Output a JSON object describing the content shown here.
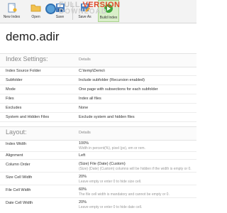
{
  "toolbar": {
    "buttons": [
      {
        "label": "New Index",
        "icon": "new-index-icon"
      },
      {
        "label": "Open",
        "icon": "open-folder-icon"
      },
      {
        "label": "Save",
        "icon": "save-icon"
      },
      {
        "label": "Save As",
        "icon": "save-as-icon"
      },
      {
        "label": "Build Index",
        "icon": "build-index-icon"
      }
    ]
  },
  "watermark": {
    "line1_a": "FULL",
    "line1_b": "VERSION",
    "line2": "DOWNLOAD"
  },
  "title": "demo.adir",
  "index_settings": {
    "heading": "Index Settings:",
    "details_label": "Details",
    "rows": [
      {
        "key": "Index Source Folder",
        "value": "C:\\temp\\Demo\\"
      },
      {
        "key": "Subfolder",
        "value": "Include subfolder (Recursion enabled)"
      },
      {
        "key": "Mode",
        "value": "One page with subsections for each subfolder"
      },
      {
        "key": "Files",
        "value": "Index all files"
      },
      {
        "key": "Excludes",
        "value": "None"
      },
      {
        "key": "System and Hidden Files",
        "value": "Exclude system and hidden files"
      }
    ]
  },
  "layout": {
    "heading": "Layout:",
    "details_label": "Details",
    "rows": [
      {
        "key": "Index Width",
        "value": "100%",
        "note": "Width in percent(%), pixel (px), em or rem."
      },
      {
        "key": "Alignment",
        "value": "Left",
        "note": ""
      },
      {
        "key": "Column Order",
        "value": "(Size) File (Date) (Custom)",
        "note": "(Size) (Date) (Custom) columns will be hidden if the width is empty or 0."
      },
      {
        "key": "Size Cell Width",
        "value": "20%",
        "note": "Leave empty or enter 0 to hide size cell."
      },
      {
        "key": "File Cell Width",
        "value": "60%",
        "note": "The file cell width is mandatory and cannot be empty or 0."
      },
      {
        "key": "Date Cell Width",
        "value": "20%",
        "note": "Leave empty or enter 0 to hide date cell."
      }
    ]
  },
  "colors": {
    "active_button": "#d9efc9",
    "accent_blue": "#2f6fb0"
  }
}
